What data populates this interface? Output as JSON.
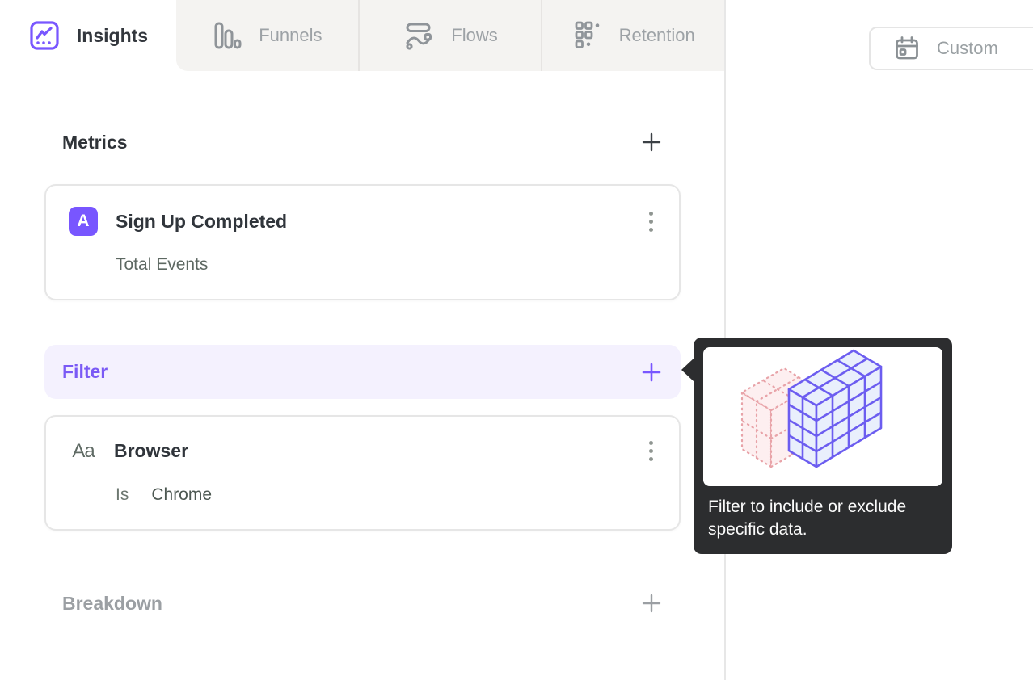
{
  "tabs": [
    {
      "label": "Insights",
      "active": true
    },
    {
      "label": "Funnels",
      "active": false
    },
    {
      "label": "Flows",
      "active": false
    },
    {
      "label": "Retention",
      "active": false
    }
  ],
  "date_button": {
    "label": "Custom"
  },
  "metrics_section": {
    "title": "Metrics"
  },
  "metric_card": {
    "badge": "A",
    "title": "Sign Up Completed",
    "subtitle": "Total Events"
  },
  "filter_section": {
    "label": "Filter"
  },
  "filter_card": {
    "icon_label": "Aa",
    "title": "Browser",
    "operator": "Is",
    "value": "Chrome"
  },
  "breakdown_section": {
    "label": "Breakdown"
  },
  "tooltip": {
    "text": "Filter to include or exclude specific data."
  },
  "icons": {
    "insights": "line-chart-icon",
    "funnels": "bar-chart-icon",
    "flows": "flow-wave-icon",
    "retention": "dot-grid-icon",
    "custom_date": "calendar-icon",
    "add": "plus-icon",
    "menu": "kebab-menu-icon",
    "filter_card": "text-property-icon"
  },
  "colors": {
    "accent": "#7856ff",
    "filter_bg": "#f4f1fe",
    "tooltip_bg": "#2c2d2f",
    "inactive_tab_bg": "#f4f3f1",
    "illustration_pink": "#e8a3a8",
    "illustration_blue_fill": "#e9effc"
  }
}
